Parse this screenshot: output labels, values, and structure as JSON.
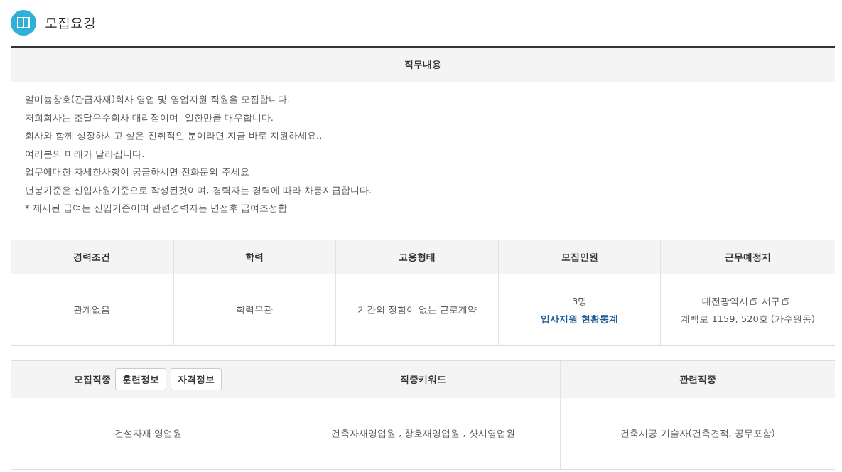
{
  "title": "모집요강",
  "job_description": {
    "heading": "직무내용",
    "lines": [
      "알미늄창호(관급자재)회사 영업 및 영업지원 직원을 모집합니다.",
      "저희회사는 조달우수회사 대리점이며  일한만큼 대우합니다.",
      "회사와 함께 성장하시고 싶은 진취적인 분이라면 지금 바로 지원하세요..",
      "여러분의 미래가 달라집니다.",
      "업무에대한 자세한사항이 궁금하시면 전화문의 주세요",
      "년봉기준은 신입사원기준으로 작성된것이며, 경력자는 경력에 따라 차등지급합니다.",
      "* 제시된 급여는 신입기준이며 관련경력자는 면접후 급여조정함"
    ]
  },
  "conditions": {
    "columns": [
      "경력조건",
      "학력",
      "고용형태",
      "모집인원",
      "근무예정지"
    ],
    "career": "관계없음",
    "education": "학력무관",
    "employment_type": "기간의 정함이 없는 근로계약",
    "headcount": "3명",
    "stats_link": "입사지원 현황통계",
    "location": [
      {
        "kind": "link",
        "text": "대전광역시"
      },
      {
        "kind": "link",
        "text": "서구"
      },
      {
        "kind": "text",
        "text": "계백로 1159, 520호 (가수원동)"
      }
    ]
  },
  "occupation": {
    "columns": [
      {
        "label": "모집직종",
        "buttons": [
          "훈련정보",
          "자격정보"
        ]
      },
      {
        "label": "직종키워드"
      },
      {
        "label": "관련직종"
      }
    ],
    "values": [
      "건설자재 영업원",
      "건축자재영업원 , 창호재영업원 , 샷시영업원",
      "건축시공 기술자(건축견적, 공무포함)"
    ]
  }
}
